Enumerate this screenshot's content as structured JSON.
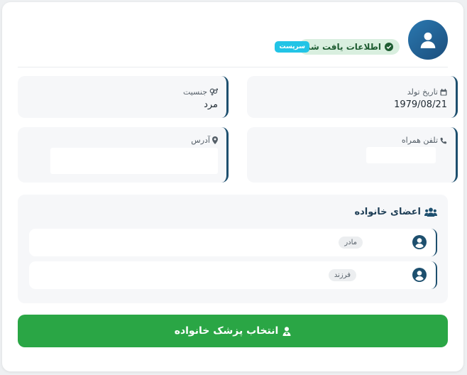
{
  "header": {
    "found_label": "اطلاعات یافت شد",
    "type_badge": "سرپست"
  },
  "fields": {
    "birth_date": {
      "label": "تاریخ تولد",
      "value": "1979/08/21"
    },
    "gender": {
      "label": "جنسیت",
      "value": "مرد"
    },
    "mobile": {
      "label": "تلفن همراه",
      "value": ""
    },
    "address": {
      "label": "آدرس",
      "value": ""
    }
  },
  "family": {
    "title": "اعضای خانواده",
    "members": [
      {
        "relation": "مادر"
      },
      {
        "relation": "فرزند"
      }
    ]
  },
  "action": {
    "label": "انتخاب پزشک خانواده"
  },
  "colors": {
    "accent": "#1d4f6e",
    "success_bg": "#d9efdf",
    "badge": "#22c4e6",
    "button": "#2aa645"
  },
  "icons": [
    "user-avatar-icon",
    "check-circle-icon",
    "calendar-icon",
    "gender-icon",
    "phone-icon",
    "map-marker-icon",
    "users-icon",
    "user-circle-icon",
    "doctor-icon"
  ]
}
